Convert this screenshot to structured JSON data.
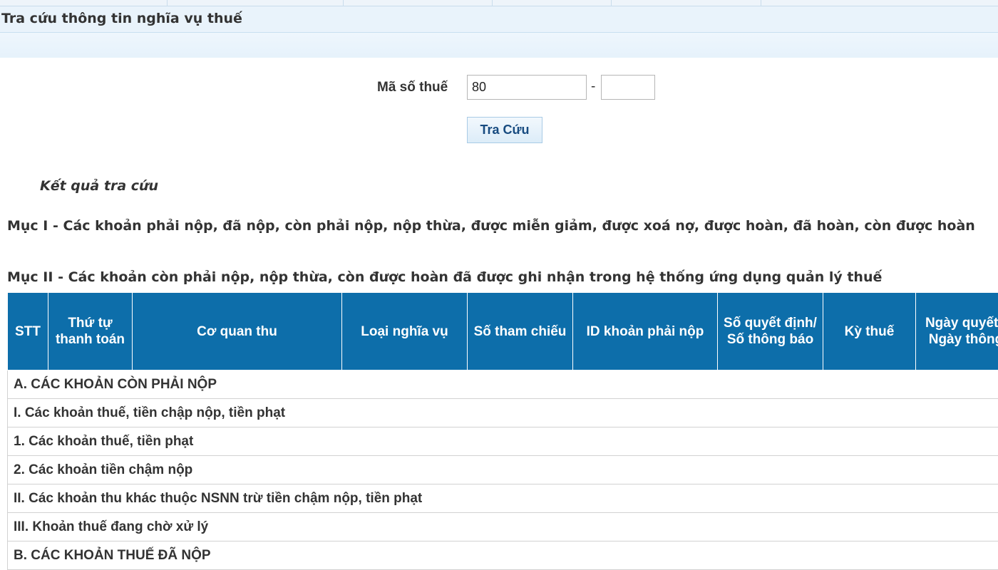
{
  "page": {
    "title": "Tra cứu thông tin nghĩa vụ thuế"
  },
  "form": {
    "tax_code_label": "Mã số thuế",
    "tax_code_value": "80",
    "dash": "-",
    "tax_code_suffix_value": "",
    "search_button": "Tra Cứu"
  },
  "results": {
    "heading": "Kết quả tra cứu",
    "section1": "Mục I - Các khoản phải nộp, đã nộp, còn phải nộp, nộp thừa, được miễn giảm, được xoá nợ, được hoàn, đã hoàn, còn được hoàn",
    "section2": "Mục II - Các khoản còn phải nộp, nộp thừa, còn được hoàn đã được ghi nhận trong hệ thống ứng dụng quản lý thuế"
  },
  "table": {
    "headers": [
      "STT",
      "Thứ tự thanh toán",
      "Cơ quan thu",
      "Loại nghĩa vụ",
      "Số tham chiếu",
      "ID khoản phải nộp",
      "Số quyết định/ Số thông báo",
      "Kỳ thuế",
      "Ngày quyết định/ Ngày thông báo"
    ],
    "rows": [
      "A. CÁC KHOẢN CÒN PHẢI NỘP",
      "I. Các khoản thuế, tiền chập nộp, tiền phạt",
      "1. Các khoản thuế, tiền phạt",
      "2. Các khoản tiền chậm nộp",
      "II. Các khoản thu khác thuộc NSNN trừ tiền chậm nộp, tiền phạt",
      "III. Khoản thuế đang chờ xử lý",
      "B. CÁC KHOẢN THUẾ ĐÃ NỘP"
    ]
  }
}
